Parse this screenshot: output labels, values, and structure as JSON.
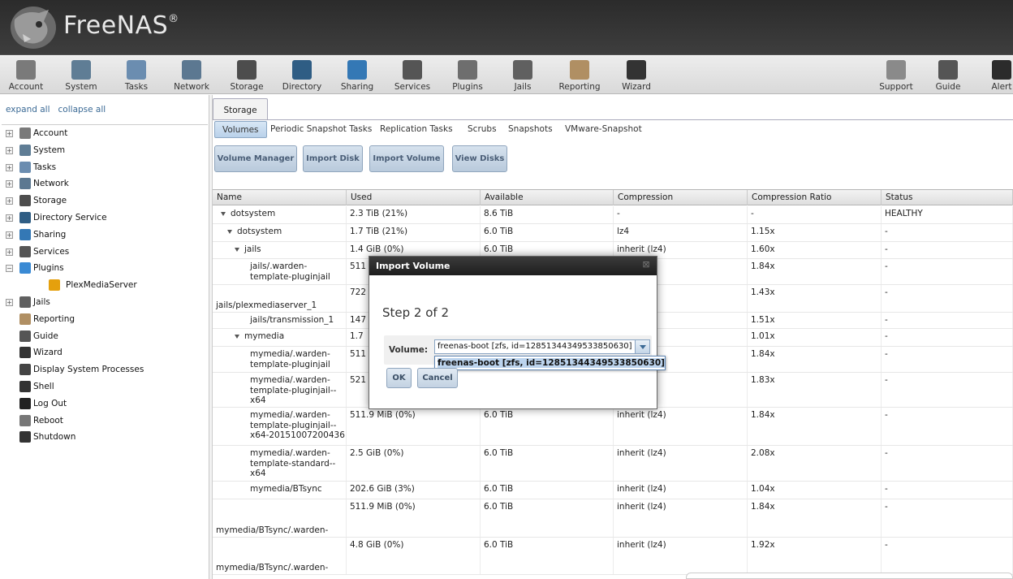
{
  "app": {
    "name": "FreeNAS",
    "mark": "®"
  },
  "toolbar": [
    {
      "label": "Account",
      "icon": "account-icon",
      "color": "#7a7a7a"
    },
    {
      "label": "System",
      "icon": "system-icon",
      "color": "#5f7d95"
    },
    {
      "label": "Tasks",
      "icon": "tasks-icon",
      "color": "#6b8db0"
    },
    {
      "label": "Network",
      "icon": "network-icon",
      "color": "#5c7891"
    },
    {
      "label": "Storage",
      "icon": "storage-icon",
      "color": "#4d4d4d"
    },
    {
      "label": "Directory",
      "icon": "directory-icon",
      "color": "#2f5d84"
    },
    {
      "label": "Sharing",
      "icon": "sharing-icon",
      "color": "#3478b5"
    },
    {
      "label": "Services",
      "icon": "services-icon",
      "color": "#555555"
    },
    {
      "label": "Plugins",
      "icon": "plugins-icon",
      "color": "#6e6e6e"
    },
    {
      "label": "Jails",
      "icon": "jails-icon",
      "color": "#606060"
    },
    {
      "label": "Reporting",
      "icon": "reporting-icon",
      "color": "#b08f63"
    },
    {
      "label": "Wizard",
      "icon": "wizard-icon",
      "color": "#333333"
    },
    {
      "label": "Support",
      "icon": "support-icon",
      "color": "#8a8a8a"
    },
    {
      "label": "Guide",
      "icon": "guide-icon",
      "color": "#555555"
    },
    {
      "label": "Alert",
      "icon": "alert-icon",
      "color": "#2b2b2b"
    }
  ],
  "sidebar": {
    "expand_all": "expand all",
    "collapse_all": "collapse all",
    "items": [
      {
        "label": "Account",
        "icon": "account-icon",
        "color": "#7a7a7a",
        "expander": "+"
      },
      {
        "label": "System",
        "icon": "system-icon",
        "color": "#5f7d95",
        "expander": "+"
      },
      {
        "label": "Tasks",
        "icon": "tasks-icon",
        "color": "#6b8db0",
        "expander": "+"
      },
      {
        "label": "Network",
        "icon": "network-icon",
        "color": "#5c7891",
        "expander": "+"
      },
      {
        "label": "Storage",
        "icon": "storage-icon",
        "color": "#4d4d4d",
        "expander": "+"
      },
      {
        "label": "Directory Service",
        "icon": "directory-icon",
        "color": "#2f5d84",
        "expander": "+"
      },
      {
        "label": "Sharing",
        "icon": "sharing-icon",
        "color": "#3478b5",
        "expander": "+"
      },
      {
        "label": "Services",
        "icon": "services-icon",
        "color": "#555555",
        "expander": "+"
      },
      {
        "label": "Plugins",
        "icon": "plugins-icon",
        "color": "#3a8ad4",
        "expander": "−"
      },
      {
        "label": "PlexMediaServer",
        "icon": "plex-icon",
        "color": "#e5a00d",
        "expander": "",
        "indent": true
      },
      {
        "label": "Jails",
        "icon": "jails-icon",
        "color": "#606060",
        "expander": "+"
      },
      {
        "label": "Reporting",
        "icon": "reporting-icon",
        "color": "#b08f63",
        "expander": ""
      },
      {
        "label": "Guide",
        "icon": "guide-icon",
        "color": "#555555",
        "expander": ""
      },
      {
        "label": "Wizard",
        "icon": "wizard-icon",
        "color": "#333333",
        "expander": ""
      },
      {
        "label": "Display System Processes",
        "icon": "processes-icon",
        "color": "#444444",
        "expander": ""
      },
      {
        "label": "Shell",
        "icon": "shell-icon",
        "color": "#333333",
        "expander": ""
      },
      {
        "label": "Log Out",
        "icon": "logout-icon",
        "color": "#222222",
        "expander": ""
      },
      {
        "label": "Reboot",
        "icon": "reboot-icon",
        "color": "#777777",
        "expander": ""
      },
      {
        "label": "Shutdown",
        "icon": "shutdown-icon",
        "color": "#333333",
        "expander": ""
      }
    ]
  },
  "main": {
    "tab": "Storage",
    "subtabs": [
      "Volumes",
      "Periodic Snapshot Tasks",
      "Replication Tasks",
      "Scrubs",
      "Snapshots",
      "VMware-Snapshot"
    ],
    "buttons": [
      "Volume Manager",
      "Import Disk",
      "Import Volume",
      "View Disks"
    ]
  },
  "grid": {
    "columns": [
      "Name",
      "Used",
      "Available",
      "Compression",
      "Compression Ratio",
      "Status"
    ],
    "rows": [
      {
        "name": "dotsystem",
        "used": "2.3 TiB (21%)",
        "avail": "8.6 TiB",
        "comp": "-",
        "ratio": "-",
        "status": "HEALTHY"
      },
      {
        "name": "dotsystem",
        "used": "1.7 TiB (21%)",
        "avail": "6.0 TiB",
        "comp": "lz4",
        "ratio": "1.15x",
        "status": "-"
      },
      {
        "name": "jails",
        "used": "1.4 GiB (0%)",
        "avail": "6.0 TiB",
        "comp": "inherit (lz4)",
        "ratio": "1.60x",
        "status": "-"
      },
      {
        "name": "jails/.warden-template-pluginjail",
        "used": "511",
        "avail": "",
        "comp": "(4)",
        "ratio": "1.84x",
        "status": "-"
      },
      {
        "name": "jails/plexmediaserver_1",
        "used": "722",
        "avail": "",
        "comp": "(4)",
        "ratio": "1.43x",
        "status": "-"
      },
      {
        "name": "jails/transmission_1",
        "used": "147",
        "avail": "",
        "comp": "(4)",
        "ratio": "1.51x",
        "status": "-"
      },
      {
        "name": "mymedia",
        "used": "1.7",
        "avail": "",
        "comp": "(4)",
        "ratio": "1.01x",
        "status": "-"
      },
      {
        "name": "mymedia/.warden-template-pluginjail",
        "used": "511",
        "avail": "",
        "comp": "(4)",
        "ratio": "1.84x",
        "status": "-"
      },
      {
        "name": "mymedia/.warden-template-pluginjail--x64",
        "used": "521",
        "avail": "",
        "comp": "(4)",
        "ratio": "1.83x",
        "status": "-"
      },
      {
        "name": "mymedia/.warden-template-pluginjail--x64-20151007200436",
        "used": "511.9 MiB (0%)",
        "avail": "6.0 TiB",
        "comp": "inherit (lz4)",
        "ratio": "1.84x",
        "status": "-"
      },
      {
        "name": "mymedia/.warden-template-standard--x64",
        "used": "2.5 GiB (0%)",
        "avail": "6.0 TiB",
        "comp": "inherit (lz4)",
        "ratio": "2.08x",
        "status": "-"
      },
      {
        "name": "mymedia/BTsync",
        "used": "202.6 GiB (3%)",
        "avail": "6.0 TiB",
        "comp": "inherit (lz4)",
        "ratio": "1.04x",
        "status": "-"
      },
      {
        "name": "mymedia/BTsync/.warden-template-pluginjail--x64",
        "used": "511.9 MiB (0%)",
        "avail": "6.0 TiB",
        "comp": "inherit (lz4)",
        "ratio": "1.84x",
        "status": "-"
      },
      {
        "name": "mymedia/BTsync/.warden-template-standard--x64",
        "used": "4.8 GiB (0%)",
        "avail": "6.0 TiB",
        "comp": "inherit (lz4)",
        "ratio": "1.92x",
        "status": "-"
      }
    ]
  },
  "dialog": {
    "title": "Import Volume",
    "step": "Step 2 of 2",
    "volume_label": "Volume:",
    "volume_value": "freenas-boot [zfs, id=12851344349533850630]",
    "option": "freenas-boot [zfs, id=12851344349533850630]",
    "ok": "OK",
    "cancel": "Cancel"
  }
}
